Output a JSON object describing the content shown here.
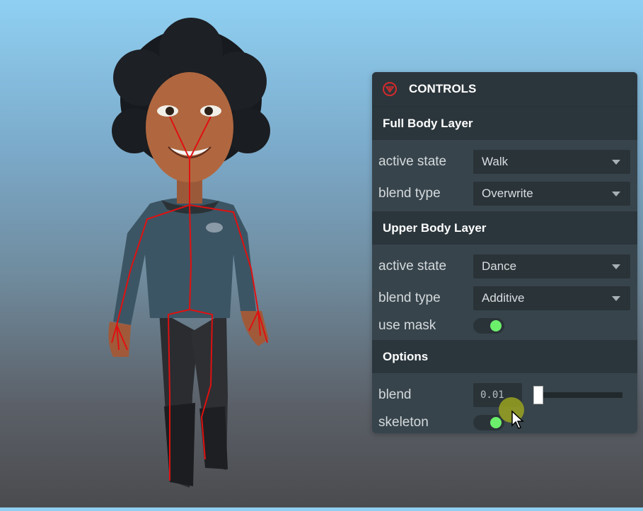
{
  "controls": {
    "title": "CONTROLS",
    "full_body": {
      "title": "Full Body Layer",
      "active_state_label": "active state",
      "active_state_value": "Walk",
      "blend_type_label": "blend type",
      "blend_type_value": "Overwrite"
    },
    "upper_body": {
      "title": "Upper Body Layer",
      "active_state_label": "active state",
      "active_state_value": "Dance",
      "blend_type_label": "blend type",
      "blend_type_value": "Additive",
      "use_mask_label": "use mask",
      "use_mask_on": true
    },
    "options": {
      "title": "Options",
      "blend_label": "blend",
      "blend_value": "0.01",
      "skeleton_label": "skeleton",
      "skeleton_on": true
    }
  },
  "colors": {
    "toggle_on": "#6cf06c",
    "skeleton_line": "#e01010",
    "logo_red": "#d42a2a"
  },
  "icons": {
    "panel_logo": "triangle-circle-icon",
    "dropdown_caret": "chevron-down-icon",
    "mouse": "mouse-pointer-icon"
  }
}
